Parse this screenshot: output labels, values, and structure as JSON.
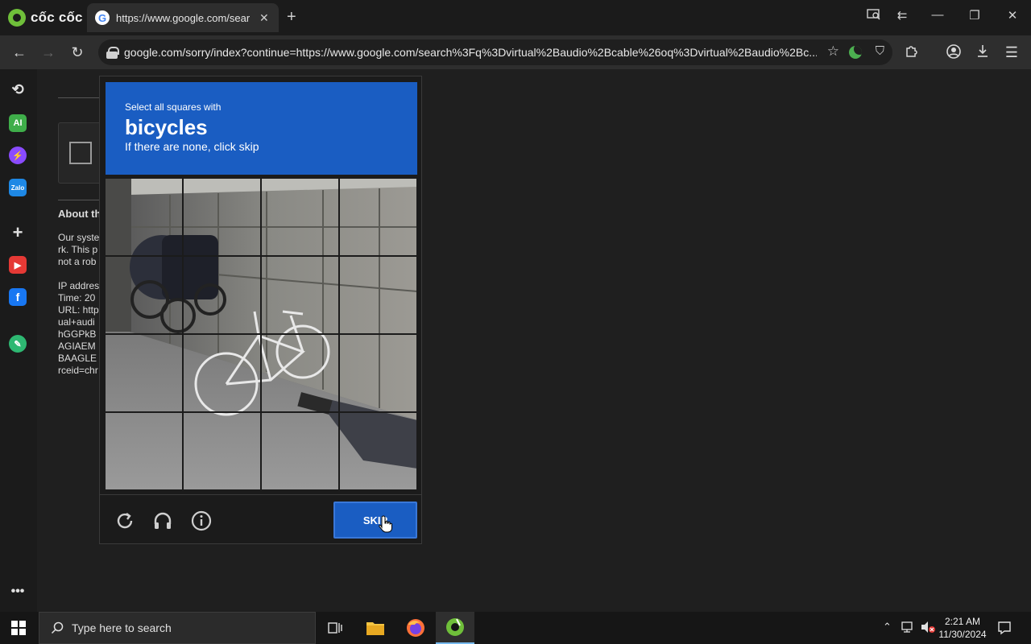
{
  "browser": {
    "brand": "cốc cốc",
    "tab_title": "https://www.google.com/sear",
    "url": "google.com/sorry/index?continue=https://www.google.com/search%3Fq%3Dvirtual%2Baudio%2Bcable%26oq%3Dvirtual%2Baudio%2Bc..."
  },
  "page": {
    "about_heading": "About th",
    "lines_1": [
      "Our syste",
      "rk. This p",
      "not a rob"
    ],
    "lines_2": [
      "IP addres",
      "Time: 20",
      "URL: http",
      "ual+audi",
      "hGGPkB",
      "AGIAEM",
      "BAAGLE",
      "rceid=chr"
    ]
  },
  "captcha": {
    "instruction": "Select all squares with",
    "target": "bicycles",
    "subtitle": "If there are none, click skip",
    "skip_label": "SKIP",
    "accent_color": "#1a5dc2"
  },
  "taskbar": {
    "search_placeholder": "Type here to search",
    "time": "2:21 AM",
    "date": "11/30/2024"
  }
}
